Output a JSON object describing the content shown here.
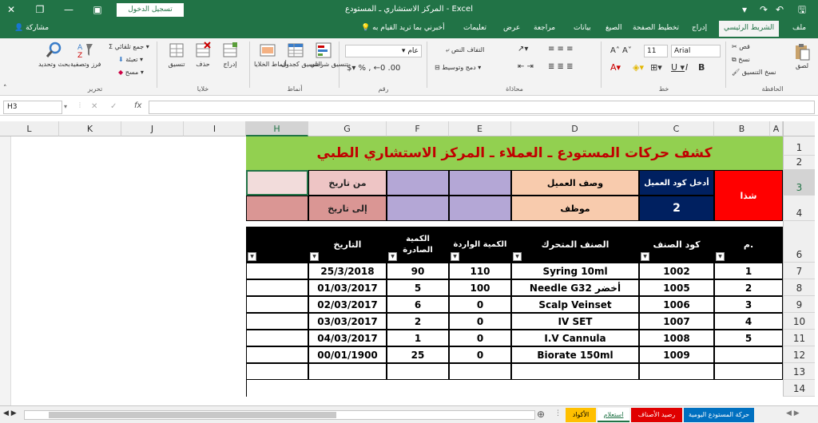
{
  "titlebar": {
    "title": "المركز الاستشاري ـ المستودع  -  Excel",
    "sign_in": "تسجيل الدخول"
  },
  "ribbon_tabs": [
    "ملف",
    "الشريط الرئيسي",
    "إدراج",
    "تخطيط الصفحة",
    "الصيغ",
    "بيانات",
    "مراجعة",
    "عرض",
    "تعليمات"
  ],
  "tell_me": "أخبرني بما تريد القيام به",
  "share": "مشاركة",
  "ribbon": {
    "clipboard": {
      "group": "الحافظة",
      "paste": "لصق",
      "cut": "قص",
      "copy": "نسخ",
      "format_painter": "نسخ التنسيق"
    },
    "font": {
      "group": "خط",
      "name": "Arial",
      "size": "11"
    },
    "alignment": {
      "group": "محاذاة",
      "wrap": "التفاف النص",
      "merge": "دمج وتوسيط"
    },
    "number": {
      "group": "رقم",
      "format": "عام"
    },
    "styles": {
      "group": "أنماط",
      "conditional": "تنسيق شرطي",
      "as_table": "التنسيق كجدول",
      "cell_styles": "أنماط الخلايا"
    },
    "cells": {
      "group": "خلايا",
      "insert": "إدراج",
      "delete": "حذف",
      "format": "تنسيق"
    },
    "editing": {
      "group": "تحرير",
      "autosum": "جمع تلقائي",
      "fill": "تعبئة",
      "clear": "مسح",
      "sort": "فرز وتصفية",
      "find": "بحث وتحديد"
    }
  },
  "formula_bar": {
    "name_box": "H3",
    "fx": "fx",
    "value": ""
  },
  "columns": [
    "A",
    "B",
    "C",
    "D",
    "E",
    "F",
    "G",
    "H",
    "I",
    "J",
    "K",
    "L"
  ],
  "rows": [
    "1",
    "2",
    "3",
    "4",
    "6",
    "7",
    "8",
    "9",
    "10",
    "11",
    "12",
    "13",
    "14"
  ],
  "sheet": {
    "title": "كشف حركات المستودع ـ العملاء ـ المركز الاستشاري الطبي",
    "filter_box": {
      "label": "شذا",
      "customer_code_label": "أدخل كود العميل",
      "customer_code": "2",
      "customer_desc_label": "وصف العميل",
      "customer_desc": "موظف",
      "from_date": "من تاريخ",
      "to_date": "إلى تاريخ"
    },
    "table_headers": {
      "num": "م.",
      "item_code": "كود الصنف",
      "item_name": "الصنف المتحرك",
      "qty_in": "الكمية الواردة",
      "qty_out": "الكمية الصادرة",
      "date": "التاريخ"
    },
    "table_rows": [
      {
        "num": "1",
        "code": "1002",
        "name": "Syring 10ml",
        "qty_in": "110",
        "qty_out": "90",
        "date": "25/3/2018"
      },
      {
        "num": "2",
        "code": "1005",
        "name": "Needle G32 أخضر",
        "qty_in": "100",
        "qty_out": "5",
        "date": "01/03/2017"
      },
      {
        "num": "3",
        "code": "1006",
        "name": "Scalp Veinset",
        "qty_in": "0",
        "qty_out": "6",
        "date": "02/03/2017"
      },
      {
        "num": "4",
        "code": "1007",
        "name": "IV SET",
        "qty_in": "0",
        "qty_out": "2",
        "date": "03/03/2017"
      },
      {
        "num": "5",
        "code": "1008",
        "name": "I.V Cannula",
        "qty_in": "0",
        "qty_out": "1",
        "date": "04/03/2017"
      },
      {
        "num": "",
        "code": "1009",
        "name": "Biorate 150ml",
        "qty_in": "0",
        "qty_out": "25",
        "date": "00/01/1900"
      }
    ]
  },
  "sheet_tabs": [
    "حركة المستودع اليومية",
    "رصيد الأصناف",
    "استعلام",
    "الأكواد"
  ],
  "colors": {
    "excel_green": "#217346",
    "title_row": "#92d050",
    "title_text": "#c00000",
    "shatha_red": "#ff0000",
    "navy": "#002060",
    "peach": "#f8cbad",
    "purple": "#b4a7d6",
    "pink": "#eec5c5",
    "rose": "#da9694"
  }
}
